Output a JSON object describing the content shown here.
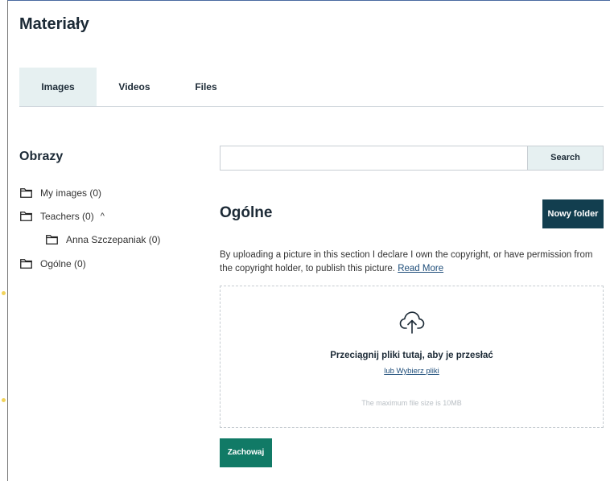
{
  "page": {
    "title": "Materiały"
  },
  "tabs": [
    {
      "label": "Images",
      "active": true
    },
    {
      "label": "Videos",
      "active": false
    },
    {
      "label": "Files",
      "active": false
    }
  ],
  "sidebar": {
    "heading": "Obrazy",
    "items": [
      {
        "label": "My images (0)"
      },
      {
        "label": "Teachers (0)",
        "chevron": "^"
      },
      {
        "label": "Anna Szczepaniak (0)"
      },
      {
        "label": "Ogólne (0)"
      }
    ]
  },
  "search": {
    "placeholder": "",
    "value": "",
    "button_label": "Search"
  },
  "section": {
    "title": "Ogólne",
    "new_folder_label": "Nowy folder",
    "notice_text": "By uploading a picture in this section I declare I own the copyright, or have permission from the copyright holder, to publish this picture.",
    "notice_link": "Read More"
  },
  "dropzone": {
    "icon": "cloud-upload-icon",
    "main_text": "Przeciągnij pliki tutaj, aby je przesłać",
    "link_text": "lub Wybierz pliki",
    "max_text": "The maximum file size is 10MB"
  },
  "actions": {
    "save_label": "Zachowaj"
  },
  "colors": {
    "primary_dark": "#123e4f",
    "primary_green": "#117a66",
    "tab_active_bg": "#e6f0f1",
    "link": "#1f4e7a"
  }
}
